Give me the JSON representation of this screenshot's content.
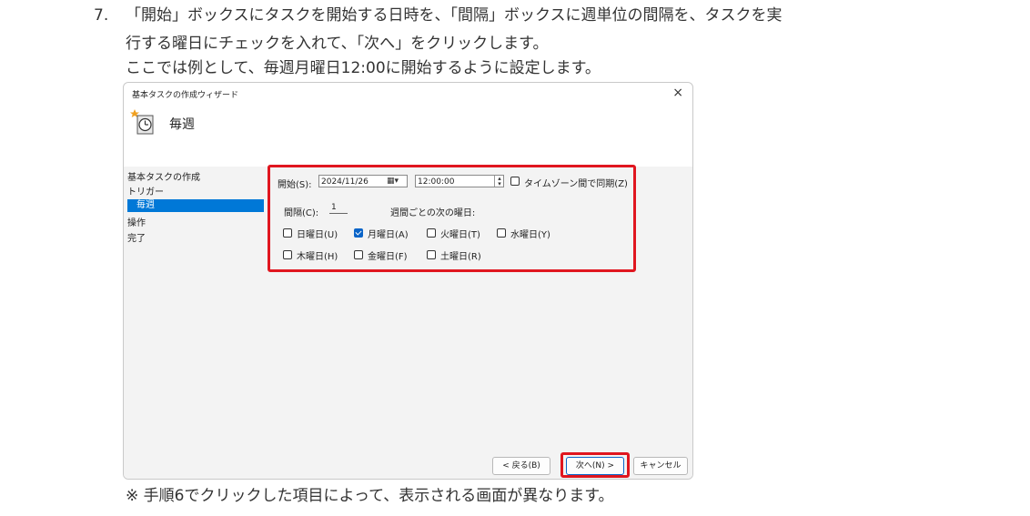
{
  "doc": {
    "step_number": "7.",
    "line1": "「開始」ボックスにタスクを開始する日時を、「間隔」ボックスに週単位の間隔を、タスクを実",
    "line2": "行する曜日にチェックを入れて、「次へ」をクリックします。",
    "line3": "ここでは例として、毎週月曜日12:00に開始するように設定します。",
    "note": "※ 手順6でクリックした項目によって、表示される画面が異なります。"
  },
  "dialog": {
    "title": "基本タスクの作成ウィザード",
    "close": "×",
    "header_title": "毎週",
    "nav": [
      "基本タスクの作成",
      "トリガー",
      "毎週",
      "操作",
      "完了"
    ],
    "start_label": "開始(S):",
    "start_date": "2024/11/26",
    "start_time": "12:00:00",
    "sync_tz_label": "タイムゾーン間で同期(Z)",
    "sync_tz_checked": false,
    "interval_label": "間隔(C):",
    "interval_value": "1",
    "weeks_label": "週間ごとの次の曜日:",
    "days": [
      {
        "label": "日曜日(U)",
        "checked": false
      },
      {
        "label": "月曜日(A)",
        "checked": true
      },
      {
        "label": "火曜日(T)",
        "checked": false
      },
      {
        "label": "水曜日(Y)",
        "checked": false
      },
      {
        "label": "木曜日(H)",
        "checked": false
      },
      {
        "label": "金曜日(F)",
        "checked": false
      },
      {
        "label": "土曜日(R)",
        "checked": false
      }
    ],
    "buttons": {
      "back": "< 戻る(B)",
      "next": "次へ(N) >",
      "cancel": "キャンセル"
    }
  },
  "colors": {
    "highlight": "#e0161f",
    "selection": "#0078d7",
    "check": "#0a64c8"
  }
}
